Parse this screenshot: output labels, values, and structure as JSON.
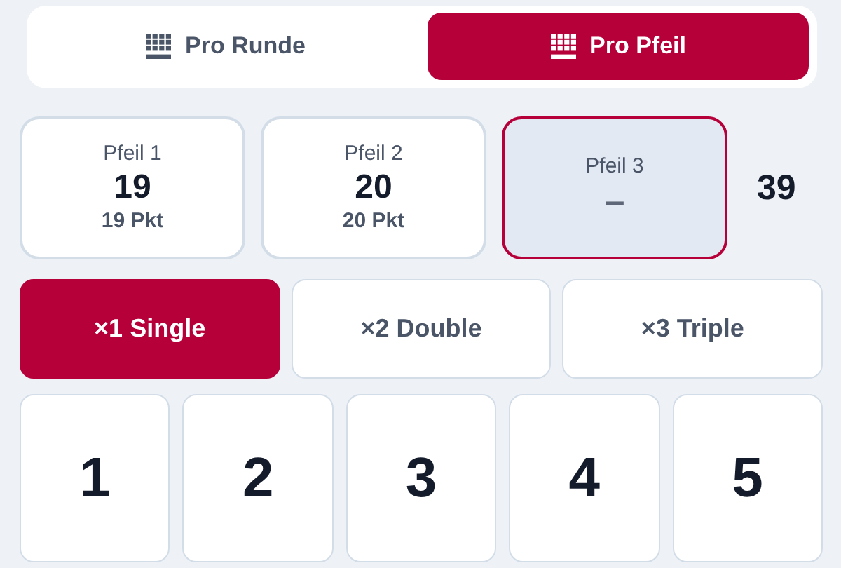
{
  "mode_tabs": [
    {
      "label": "Pro Runde",
      "selected": false
    },
    {
      "label": "Pro Pfeil",
      "selected": true
    }
  ],
  "darts": [
    {
      "label": "Pfeil 1",
      "value": "19",
      "points": "19 Pkt",
      "selected": false
    },
    {
      "label": "Pfeil 2",
      "value": "20",
      "points": "20 Pkt",
      "selected": false
    },
    {
      "label": "Pfeil 3",
      "value": "–",
      "selected": true
    }
  ],
  "total": "39",
  "multipliers": [
    {
      "label": "×1 Single",
      "selected": true
    },
    {
      "label": "×2 Double",
      "selected": false
    },
    {
      "label": "×3 Triple",
      "selected": false
    }
  ],
  "numbers": [
    "1",
    "2",
    "3",
    "4",
    "5"
  ]
}
